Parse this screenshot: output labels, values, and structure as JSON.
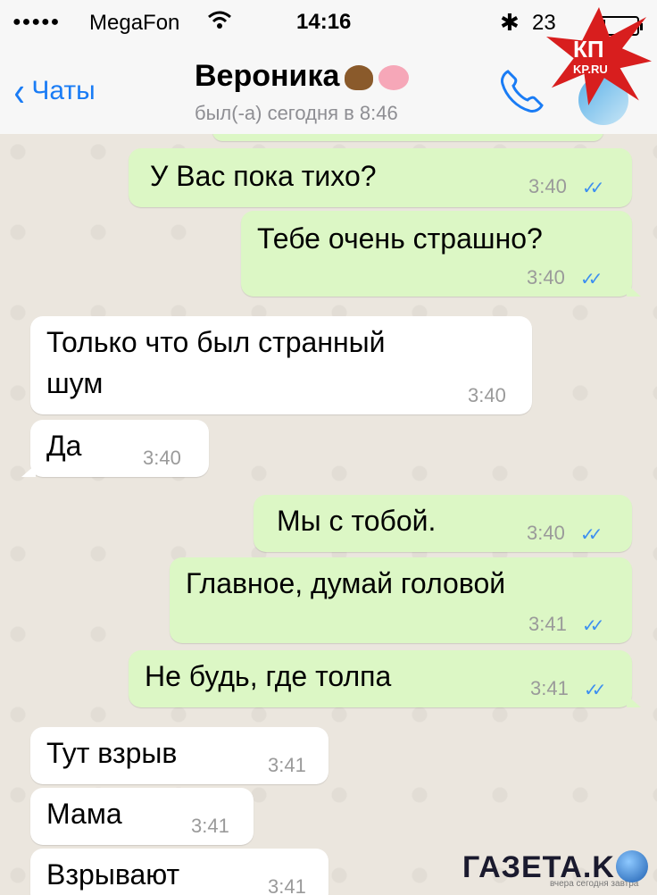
{
  "status_bar": {
    "signal": "●●●●●",
    "carrier": "MegaFon",
    "wifi_icon": "wifi-icon",
    "time": "14:16",
    "bluetooth": "✱",
    "battery_text": "23"
  },
  "nav": {
    "back_label": "Чаты",
    "title": "Вероника",
    "subtitle": "был(-а) сегодня в 8:46"
  },
  "corner_logo": {
    "line1": "КП",
    "line2": "KP.RU"
  },
  "messages": [
    {
      "text": "У Вас пока тихо?",
      "time": "3:40",
      "dir": "out",
      "checks": "✓✓"
    },
    {
      "text": "Тебе очень страшно?",
      "time": "3:40",
      "dir": "out",
      "checks": "✓✓"
    },
    {
      "text": "Только что был странный",
      "text2": "шум",
      "time": "3:40",
      "dir": "in"
    },
    {
      "text": "Да",
      "time": "3:40",
      "dir": "in"
    },
    {
      "text": "Мы с тобой.",
      "time": "3:40",
      "dir": "out",
      "checks": "✓✓"
    },
    {
      "text": "Главное, думай головой",
      "time": "3:41",
      "dir": "out",
      "checks": "✓✓"
    },
    {
      "text": "Не будь, где толпа",
      "time": "3:41",
      "dir": "out",
      "checks": "✓✓"
    },
    {
      "text": "Тут взрыв",
      "time": "3:41",
      "dir": "in"
    },
    {
      "text": "Мама",
      "time": "3:41",
      "dir": "in"
    },
    {
      "text": "Взрывают",
      "time": "3:41",
      "dir": "in"
    }
  ],
  "watermark": {
    "text": "ГАЗЕТА.KG",
    "sub": "вчера сегодня завтра"
  }
}
